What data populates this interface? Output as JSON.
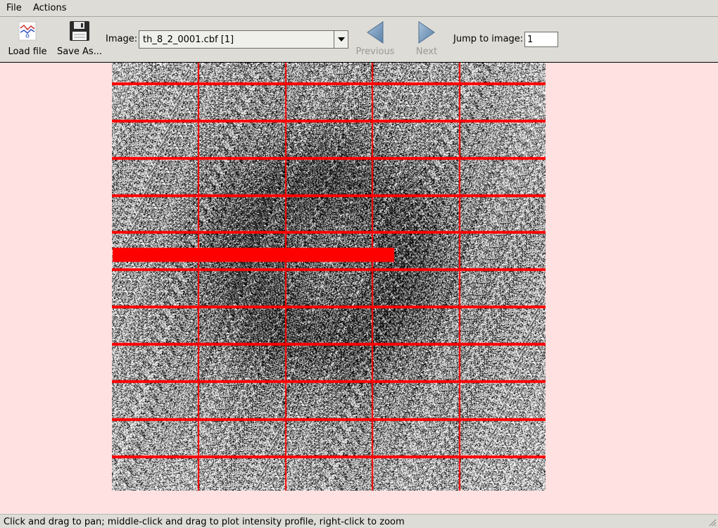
{
  "menubar": {
    "items": [
      {
        "label": "File"
      },
      {
        "label": "Actions"
      }
    ]
  },
  "toolbar": {
    "load_label": "Load file",
    "save_label": "Save As...",
    "image_label": "Image:",
    "image_value": "th_8_2_0001.cbf [1]",
    "previous_label": "Previous",
    "next_label": "Next",
    "jump_label": "Jump to image:",
    "jump_value": "1"
  },
  "viewer": {
    "overlay_color": "#ff0000",
    "background_color": "#ffe1e1"
  },
  "status": {
    "text": "Click and drag to pan; middle-click and drag to plot intensity profile, right-click to zoom"
  }
}
